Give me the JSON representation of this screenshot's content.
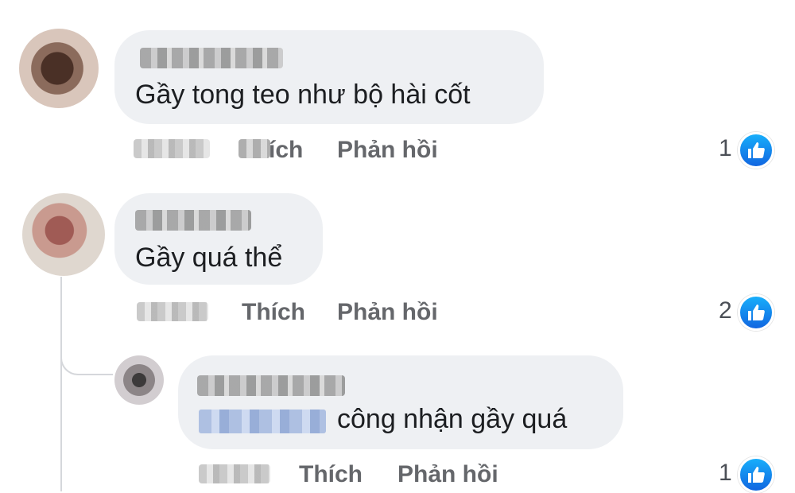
{
  "comments": [
    {
      "text": "Gầy tong teo như bộ hài cốt",
      "like_label": "ích",
      "reply_label": "Phản hồi",
      "reaction_count": "1",
      "reaction_icon": "thumbs-up-icon"
    },
    {
      "text": "Gầy quá thể",
      "like_label": "Thích",
      "reply_label": "Phản hồi",
      "reaction_count": "2",
      "reaction_icon": "thumbs-up-icon"
    },
    {
      "text": "công nhận gầy quá",
      "like_label": "Thích",
      "reply_label": "Phản hồi",
      "reaction_count": "1",
      "reaction_icon": "thumbs-up-icon"
    }
  ],
  "colors": {
    "bubble": "#eef0f3",
    "action_text": "#65676b",
    "like_blue": "#1877f2"
  }
}
